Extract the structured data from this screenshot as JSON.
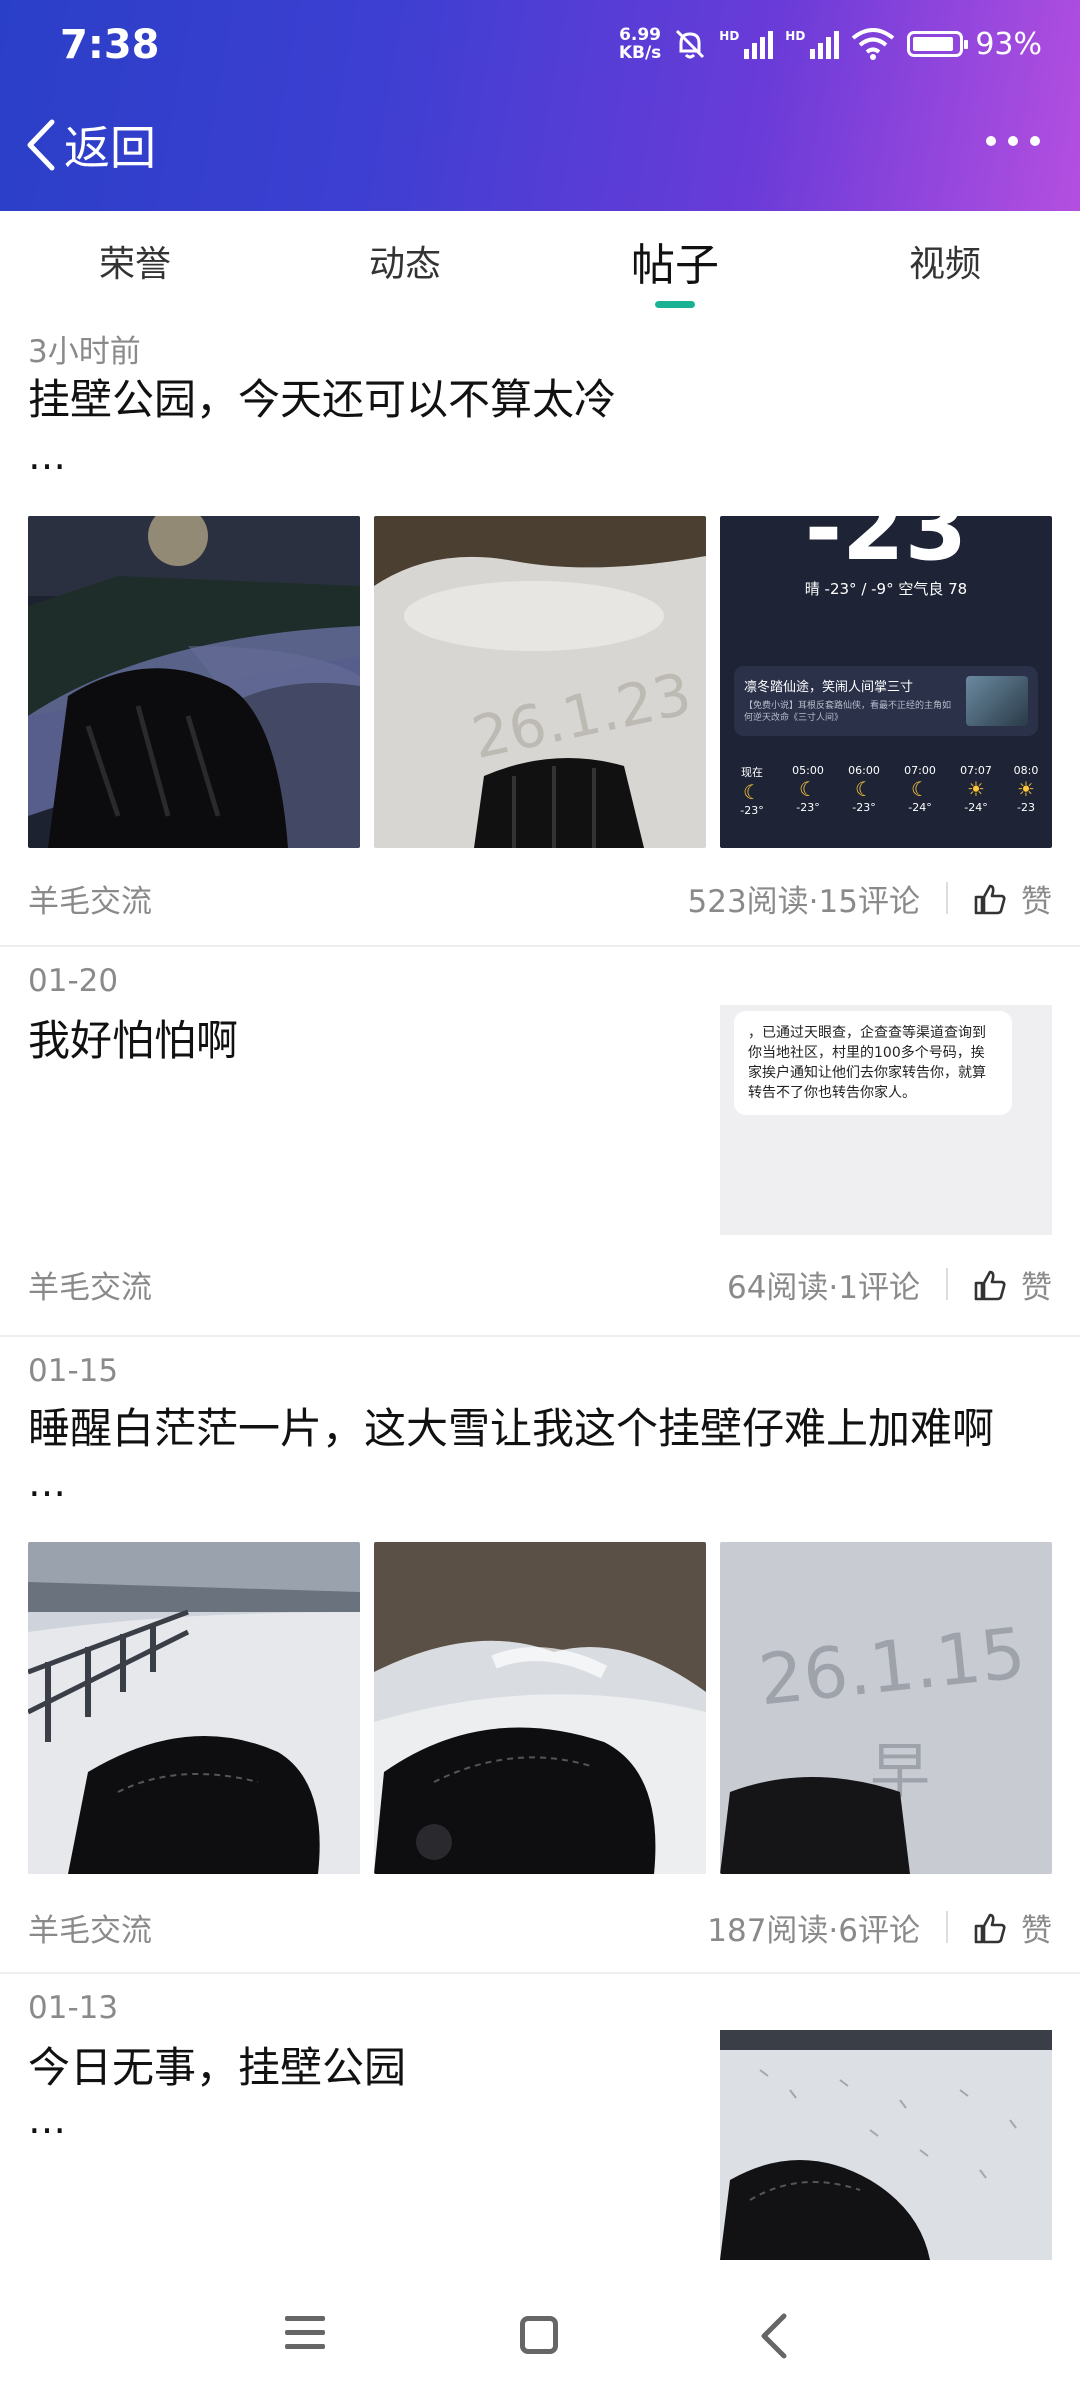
{
  "status_bar": {
    "time": "7:38",
    "net_speed_value": "6.99",
    "net_speed_unit": "KB/s",
    "battery": "93%",
    "hd_label": "HD"
  },
  "header": {
    "back_label": "返回"
  },
  "tabs": [
    {
      "label": "荣誉"
    },
    {
      "label": "动态"
    },
    {
      "label": "帖子",
      "active": true
    },
    {
      "label": "视频"
    }
  ],
  "posts": [
    {
      "date": "3小时前",
      "title": "挂壁公园，今天还可以不算太冷",
      "ellipsis": "…",
      "images": [
        "snowy-path-glove",
        "snow-writing-26-1-23",
        "weather-app-screenshot"
      ],
      "weather_shot": {
        "temp": "-23",
        "summary": "晴 -23° / -9°  空气良 78",
        "ad_title": "凛冬踏仙途，笑闹人间掌三寸",
        "ad_text": "【免费小说】耳根反套路仙侠，看最不正经的主角如何逆天改命《三寸人间》",
        "hours": [
          "现在",
          "05:00",
          "06:00",
          "07:00",
          "07:07",
          "08:0"
        ],
        "temps": [
          "-23°",
          "-23°",
          "-23°",
          "-24°",
          "-24°",
          "-23"
        ]
      },
      "source": "羊毛交流",
      "stats": "523阅读·15评论",
      "like": "赞"
    },
    {
      "date": "01-20",
      "title": "我好怕怕啊",
      "message_text": "，已通过天眼查，企查查等渠道查询到你当地社区，村里的100多个号码，挨家挨户通知让他们去你家转告你，就算转告不了你也转告你家人。",
      "source": "羊毛交流",
      "stats": "64阅读·1评论",
      "like": "赞"
    },
    {
      "date": "01-15",
      "title": "睡醒白茫茫一片，这大雪让我这个挂壁仔难上加难啊",
      "ellipsis": "…",
      "images": [
        "snowy-bridge-glove",
        "snowy-road-glove",
        "snow-writing-26-1-15"
      ],
      "source": "羊毛交流",
      "stats": "187阅读·6评论",
      "like": "赞"
    },
    {
      "date": "01-13",
      "title": "今日无事，挂壁公园",
      "ellipsis": "…",
      "images": [
        "snow-footprints-glove"
      ]
    }
  ],
  "colors": {
    "accent": "#19b394",
    "header_gradient_start": "#2a3fc7",
    "header_gradient_end": "#b44fe0",
    "muted_text": "#8a8a8a"
  }
}
